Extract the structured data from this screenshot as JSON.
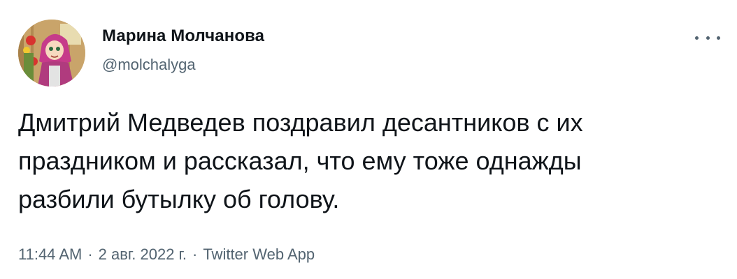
{
  "author": {
    "name": "Марина Молчанова",
    "handle": "@molchalyga",
    "avatar_icon": "avatar-masha-cartoon"
  },
  "more_icon": "more-dots-icon",
  "tweet": {
    "lines": [
      "Дмитрий Медведев поздравил десантников с их",
      "праздником и рассказал, что ему тоже однажды",
      "разбили бутылку об голову."
    ]
  },
  "meta": {
    "time": "11:44 AM",
    "date": "2 авг. 2022 г.",
    "source": "Twitter Web App",
    "separator": "·"
  },
  "colors": {
    "text": "#0f1419",
    "secondary": "#536471",
    "background": "#ffffff"
  }
}
